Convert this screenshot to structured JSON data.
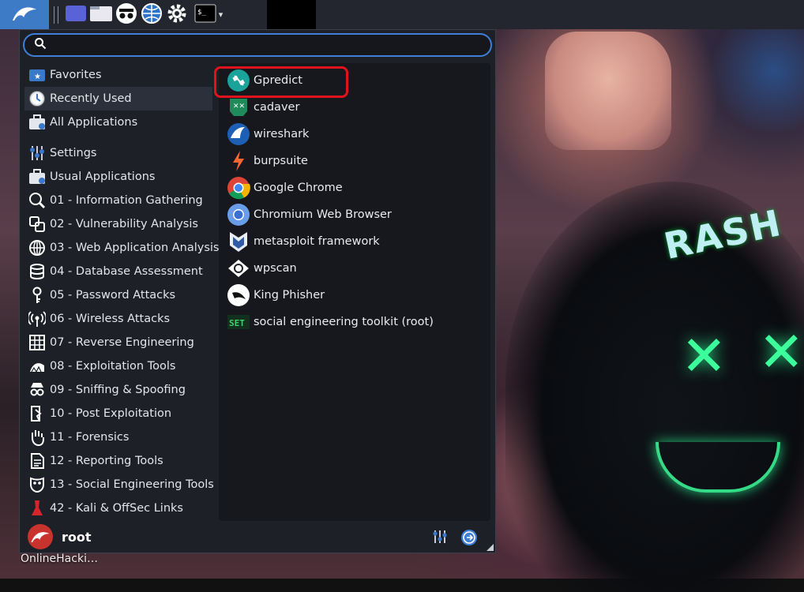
{
  "panel": {
    "icons": [
      "kali-dragon-icon",
      "workspace-icon",
      "file-manager-icon",
      "incognito-icon",
      "web-browser-icon",
      "settings-gear-icon",
      "terminal-icon",
      "chevron-down-icon"
    ]
  },
  "search": {
    "value": "",
    "placeholder": ""
  },
  "categories": [
    {
      "label": "Favorites",
      "icon": "star-folder-icon"
    },
    {
      "label": "Recently Used",
      "icon": "clock-icon"
    },
    {
      "label": "All Applications",
      "icon": "briefcase-icon"
    },
    {
      "label": "Settings",
      "icon": "sliders-icon"
    },
    {
      "label": "Usual Applications",
      "icon": "briefcase-icon"
    },
    {
      "label": "01 - Information Gathering",
      "icon": "magnifier-icon"
    },
    {
      "label": "02 - Vulnerability Analysis",
      "icon": "vulnerability-icon"
    },
    {
      "label": "03 - Web Application Analysis",
      "icon": "globe-icon"
    },
    {
      "label": "04 - Database Assessment",
      "icon": "database-icon"
    },
    {
      "label": "05 - Password Attacks",
      "icon": "key-icon"
    },
    {
      "label": "06 - Wireless Attacks",
      "icon": "wireless-icon"
    },
    {
      "label": "07 - Reverse Engineering",
      "icon": "chip-icon"
    },
    {
      "label": "08 - Exploitation Tools",
      "icon": "kali-dragon-icon"
    },
    {
      "label": "09 - Sniffing & Spoofing",
      "icon": "spy-icon"
    },
    {
      "label": "10 - Post Exploitation",
      "icon": "door-icon"
    },
    {
      "label": "11 - Forensics",
      "icon": "hand-icon"
    },
    {
      "label": "12 - Reporting Tools",
      "icon": "document-icon"
    },
    {
      "label": "13 - Social Engineering Tools",
      "icon": "mask-icon"
    },
    {
      "label": "42 - Kali & OffSec Links",
      "icon": "offsec-icon"
    }
  ],
  "apps": [
    {
      "label": "Gpredict",
      "icon": "satellite-icon"
    },
    {
      "label": "cadaver",
      "icon": "cadaver-icon"
    },
    {
      "label": "wireshark",
      "icon": "shark-fin-icon"
    },
    {
      "label": "burpsuite",
      "icon": "burp-bolt-icon"
    },
    {
      "label": "Google Chrome",
      "icon": "chrome-icon"
    },
    {
      "label": "Chromium Web Browser",
      "icon": "chromium-icon"
    },
    {
      "label": "metasploit framework",
      "icon": "metasploit-icon"
    },
    {
      "label": "wpscan",
      "icon": "wpscan-icon"
    },
    {
      "label": "King Phisher",
      "icon": "king-phisher-icon"
    },
    {
      "label": "social engineering toolkit (root)",
      "icon": "set-icon"
    }
  ],
  "user": {
    "name": "root"
  },
  "desktop": {
    "caption": "OnlineHacki…",
    "wallpaper_text": "RASH"
  },
  "colors": {
    "panel_bg": "#23262e",
    "menu_bg": "#1d2027",
    "accent": "#3f7fd8",
    "highlight_red": "#e0131d"
  }
}
